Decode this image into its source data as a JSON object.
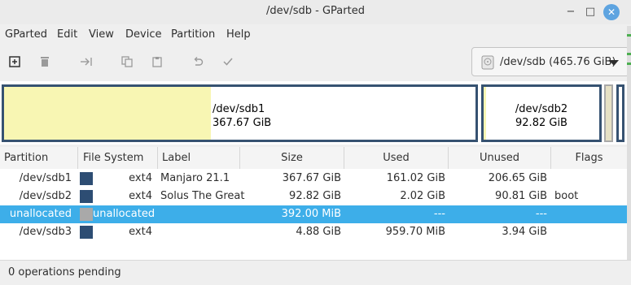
{
  "window": {
    "title": "/dev/sdb - GParted",
    "min_glyph": "−",
    "max_glyph": "□",
    "close_glyph": "✕"
  },
  "menu": [
    "GParted",
    "Edit",
    "View",
    "Device",
    "Partition",
    "Help"
  ],
  "toolbar": {
    "icons": [
      "new-partition-icon",
      "delete-icon",
      "resize-move-icon",
      "copy-icon",
      "paste-icon",
      "undo-icon",
      "apply-icon"
    ]
  },
  "device_selector": {
    "label": "/dev/sdb (465.76 GiB)"
  },
  "partition_map": [
    {
      "name": "/dev/sdb1",
      "size": "367.67 GiB",
      "used_fraction": 0.438
    },
    {
      "name": "/dev/sdb2",
      "size": "92.82 GiB",
      "used_fraction": 0.022
    }
  ],
  "table": {
    "headers": [
      "Partition",
      "File System",
      "Label",
      "Size",
      "Used",
      "Unused",
      "Flags"
    ],
    "rows": [
      {
        "partition": "/dev/sdb1",
        "filesystem": "ext4",
        "fs_color": "#2d4d73",
        "label": "Manjaro 21.1",
        "size": "367.67 GiB",
        "used": "161.02 GiB",
        "unused": "206.65 GiB",
        "flags": "",
        "selected": false
      },
      {
        "partition": "/dev/sdb2",
        "filesystem": "ext4",
        "fs_color": "#2d4d73",
        "label": "Solus The Great",
        "size": "92.82 GiB",
        "used": "2.02 GiB",
        "unused": "90.81 GiB",
        "flags": "boot",
        "selected": false
      },
      {
        "partition": "unallocated",
        "filesystem": "unallocated",
        "fs_color": "#a9a9a9",
        "label": "",
        "size": "392.00 MiB",
        "used": "---",
        "unused": "---",
        "flags": "",
        "selected": true
      },
      {
        "partition": "/dev/sdb3",
        "filesystem": "ext4",
        "fs_color": "#2d4d73",
        "label": "",
        "size": "4.88 GiB",
        "used": "959.70 MiB",
        "unused": "3.94 GiB",
        "flags": "",
        "selected": false
      }
    ]
  },
  "status": {
    "text": "0 operations pending"
  }
}
